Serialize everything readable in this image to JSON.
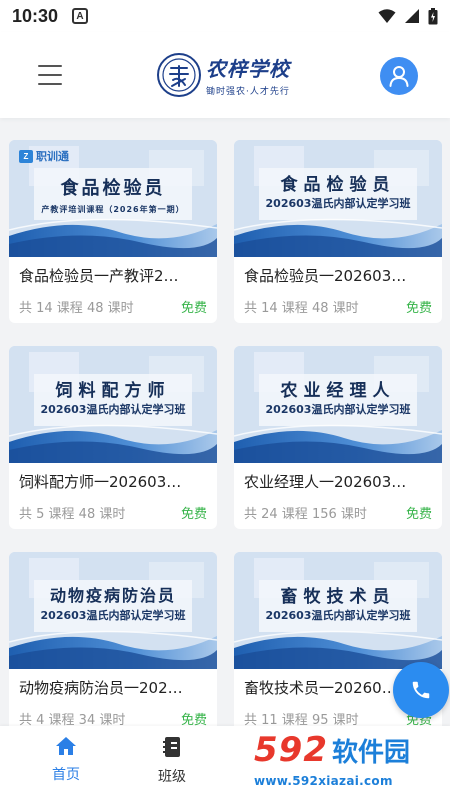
{
  "status_bar": {
    "time": "10:30",
    "notification_letter": "A"
  },
  "header": {
    "logo_title": "农梓学校",
    "logo_slogan": "锄时强农·人才先行"
  },
  "courses": [
    {
      "name": "食品检验员一产教评2…",
      "cover_title": "食品检验员",
      "cover_sub": "产教评培训课程（2026年第一期）",
      "badge": "职训通",
      "meta": "共 14 课程 48 课时",
      "price": "免费"
    },
    {
      "name": "食品检验员一202603…",
      "cover_title": "食品检验员",
      "cover_sub": "202603温氏内部认定学习班",
      "badge": "",
      "meta": "共 14 课程 48 课时",
      "price": "免费"
    },
    {
      "name": "饲料配方师一202603…",
      "cover_title": "饲料配方师",
      "cover_sub": "202603温氏内部认定学习班",
      "badge": "",
      "meta": "共 5 课程 48 课时",
      "price": "免费"
    },
    {
      "name": "农业经理人一202603…",
      "cover_title": "农业经理人",
      "cover_sub": "202603温氏内部认定学习班",
      "badge": "",
      "meta": "共 24 课程 156 课时",
      "price": "免费"
    },
    {
      "name": "动物疫病防治员一202…",
      "cover_title": "动物疫病防治员",
      "cover_sub": "202603温氏内部认定学习班",
      "badge": "",
      "meta": "共 4 课程 34 课时",
      "price": "免费"
    },
    {
      "name": "畜牧技术员一20260…",
      "cover_title": "畜牧技术员",
      "cover_sub": "202603温氏内部认定学习班",
      "badge": "",
      "meta": "共 11 课程 95 课时",
      "price": "免费"
    }
  ],
  "nav": {
    "home_label": "首页",
    "class_label": "班级"
  },
  "watermark": {
    "number": "592",
    "name": "软件园",
    "url": "www.592xiazai.com"
  },
  "colors": {
    "primary": "#3f8ef2",
    "free": "#37b44a",
    "nav_active": "#2b7fe6"
  }
}
